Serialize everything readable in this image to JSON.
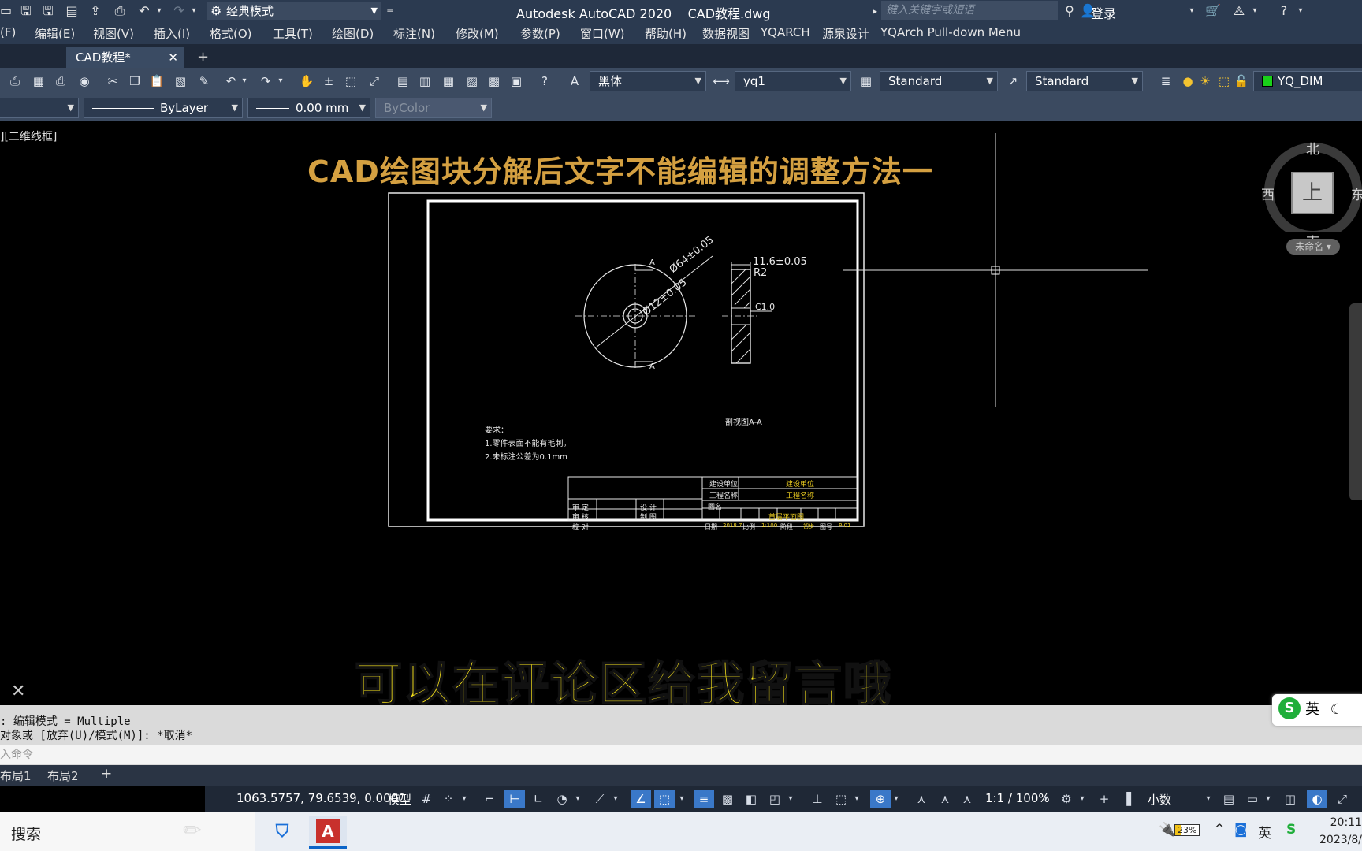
{
  "titlebar": {
    "workspace": "经典模式",
    "app_title": "Autodesk AutoCAD 2020    CAD教程.dwg",
    "search_placeholder": "键入关键字或短语",
    "login": "登录"
  },
  "menu": [
    "(F)",
    "编辑(E)",
    "视图(V)",
    "插入(I)",
    "格式(O)",
    "工具(T)",
    "绘图(D)",
    "标注(N)",
    "修改(M)",
    "参数(P)",
    "窗口(W)",
    "帮助(H)",
    "数据视图",
    "YQARCH",
    "源泉设计",
    "YQArch Pull-down Menu"
  ],
  "doc_tab": {
    "label": "CAD教程*",
    "close": "✕",
    "add": "+"
  },
  "toolbar1": {
    "text_style": "黑体",
    "dim_style": "yq1",
    "table_style": "Standard",
    "multileader_style": "Standard",
    "layer": "YQ_DIM"
  },
  "toolbar2": {
    "linetype": "ByLayer",
    "lineweight": "0.00 mm",
    "plotstyle": "ByColor"
  },
  "canvas": {
    "viewport_label": "][二维线框]",
    "heading": "CAD绘图块分解后文字不能编辑的调整方法一",
    "subtitle": "可以在评论区给我留言哦",
    "close_mark": "✕"
  },
  "drawing": {
    "dim_outer": "Ø64±0.05",
    "dim_inner": "Ø12±0.05",
    "section_a": "A",
    "dim_thickness": "11.6±0.05",
    "dim_radius": "R2",
    "dim_chamfer": "C1.0",
    "section_label": "剖视图A-A",
    "notes_title": "要求：",
    "note1": "1.零件表面不能有毛刺。",
    "note2": "2.未标注公差为0.1mm",
    "tb_build_unit_label": "建设单位",
    "tb_build_unit_value": "建设单位",
    "tb_project_label": "工程名称",
    "tb_project_value": "工程名称",
    "tb_drawing_label": "图名",
    "tb_drawing_value": "首层平面图",
    "tb_approve": "审 定",
    "tb_review": "审 核",
    "tb_check": "校 对",
    "tb_design": "设 计",
    "tb_draw": "制 图",
    "tb_date_label": "日期",
    "tb_date_value": "2018.7",
    "tb_scale_label": "比例",
    "tb_scale_value": "1:100",
    "tb_stage_label": "阶段",
    "tb_stage_value": "初步",
    "tb_no_label": "图号",
    "tb_no_value": "P-01"
  },
  "viewcube": {
    "north": "北",
    "south": "南",
    "west": "西",
    "east": "东",
    "face": "上",
    "ucs": "未命名 ▾"
  },
  "command": {
    "line1": ": 编辑模式 = Multiple",
    "line2": "对象或 [放弃(U)/模式(M)]: *取消*",
    "prompt": "入命令"
  },
  "layout_tabs": [
    "布局1",
    "布局2",
    "+"
  ],
  "status": {
    "coords": "1063.5757, 79.6539, 0.0000",
    "model": "模型",
    "scale": "1:1 / 100%",
    "units": "小数"
  },
  "taskbar": {
    "search": "搜索",
    "battery": "23%",
    "ime": "英",
    "time": "20:11",
    "date": "2023/8/"
  },
  "ime_bar": {
    "logo": "S",
    "lang": "英"
  },
  "colors": {
    "heading": "#d4a041",
    "subtitle": "#f8e31a",
    "titleblock_text": "#f0d020",
    "layer_color": "#19d119"
  }
}
